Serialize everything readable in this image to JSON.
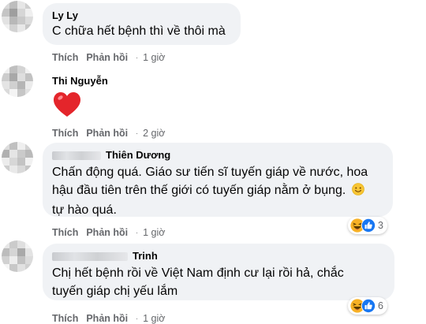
{
  "labels": {
    "like": "Thích",
    "reply": "Phản hồi",
    "separator": "·"
  },
  "comments": [
    {
      "name": "Ly Ly",
      "text": "C chữa hết bệnh thì về thôi mà",
      "time": "1 giờ"
    },
    {
      "name": "Thi Nguyễn",
      "emoji": "heart",
      "time": "2 giờ"
    },
    {
      "name": "Thiên Dương",
      "lines": [
        "Chấn động quá. Giáo sư tiến sĩ tuyến giáp về nước, hoa",
        "hậu đầu tiên trên thế giới có tuyến giáp nằm ở bụng.",
        "tự hào quá."
      ],
      "time": "1 giờ",
      "reaction_count": "3"
    },
    {
      "name": "Trinh",
      "lines": [
        "Chị hết bệnh rồi về Việt Nam định cư lại rồi hả, chắc",
        "tuyến giáp chị yếu lắm"
      ],
      "time": "1 giờ",
      "reaction_count": "6"
    }
  ],
  "icons": [
    "heart-emoji-icon",
    "smile-emoji-icon",
    "haha-reaction-icon",
    "like-reaction-icon"
  ],
  "colors": {
    "bubble": "#f0f2f5",
    "meta": "#65676b",
    "heart": "#e4252b",
    "like": "#1877f2",
    "haha": "#f7b125"
  }
}
